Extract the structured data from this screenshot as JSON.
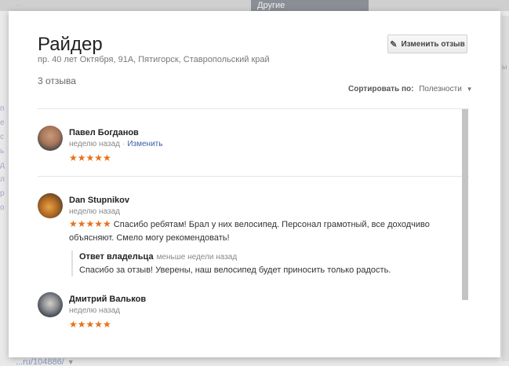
{
  "background": {
    "top_link_text": "...",
    "thumb_label": "Другие",
    "bottom_link_text": "...ru/104886/",
    "left_edge_chars": [
      "п",
      "е",
      "с",
      "ь",
      "д",
      "л",
      "р",
      "о"
    ],
    "right_edge_char": "ы"
  },
  "place": {
    "title": "Райдер",
    "address": "пр. 40 лет Октября, 91А, Пятигорск, Ставропольский край",
    "review_count": "3 отзыва"
  },
  "actions": {
    "edit_review_label": "Изменить отзыв"
  },
  "sort": {
    "label": "Сортировать по:",
    "value": "Полезности"
  },
  "reviews": [
    {
      "author": "Павел Богданов",
      "time": "неделю назад",
      "edit_link": "Изменить",
      "stars": "★★★★★",
      "text": ""
    },
    {
      "author": "Dan Stupnikov",
      "time": "неделю назад",
      "stars": "★★★★★",
      "text": "Спасибо ребятам! Брал у них велосипед. Персонал грамотный, все доходчиво объясняют. Смело могу рекомендовать!",
      "owner_reply": {
        "label": "Ответ владельца",
        "time": "меньше недели назад",
        "text": "Спасибо за отзыв! Уверены, наш велосипед будет приносить только радость."
      }
    },
    {
      "author": "Дмитрий Вальков",
      "time": "неделю назад",
      "stars": "★★★★★",
      "text": ""
    }
  ],
  "colors": {
    "star": "#e7711b",
    "link": "#3a5ea8",
    "scrollbar": "#c4c4c4"
  },
  "icons": {
    "edit": "pencil-icon",
    "sort_caret": "caret-down-icon"
  }
}
